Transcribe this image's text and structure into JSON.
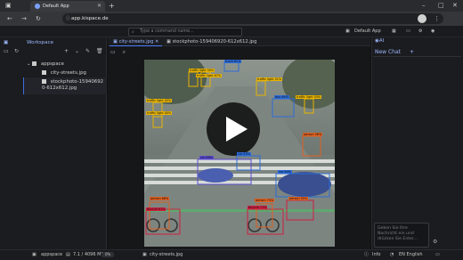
{
  "browser": {
    "tab_title": "Default App",
    "new_tab": "+",
    "url": "app.kispace.de",
    "minimize": "–",
    "maximize": "□",
    "close": "✕",
    "back": "←",
    "forward": "→",
    "reload": "↻",
    "menu": "⋮"
  },
  "apptop": {
    "command_placeholder": "Type a command name...",
    "app_name": "Default App"
  },
  "workspace": {
    "title": "Workspace",
    "root": "appspace",
    "files": [
      "city-streets.jpg",
      "stockphoto-159406920-612x612.jpg"
    ]
  },
  "editor": {
    "tabs": [
      "city-streets.jpg",
      "stockphoto-159406920-612x612.jpg"
    ],
    "detections": [
      {
        "label": "traffic light 50%",
        "color": "#e8b400"
      },
      {
        "label": "traffic light 67%",
        "color": "#e8b400"
      },
      {
        "label": "traffic light 51%",
        "color": "#e8b400"
      },
      {
        "label": "traffic light 45%",
        "color": "#e8b400"
      },
      {
        "label": "traffic light 40%",
        "color": "#e8b400"
      },
      {
        "label": "traffic light 54%",
        "color": "#e8b400"
      },
      {
        "label": "truck 61%",
        "color": "#2b6bd8"
      },
      {
        "label": "bus 49%",
        "color": "#2b6bd8"
      },
      {
        "label": "car 43%",
        "color": "#2b6bd8"
      },
      {
        "label": "person 58%",
        "color": "#e06020"
      },
      {
        "label": "car 88%",
        "color": "#5a4ad0"
      },
      {
        "label": "car 64%",
        "color": "#2b6bd8"
      },
      {
        "label": "person 66%",
        "color": "#e06020"
      },
      {
        "label": "bicycle 61%",
        "color": "#d02040"
      },
      {
        "label": "bicycle 71%",
        "color": "#d02040"
      },
      {
        "label": "person 73%",
        "color": "#e06020"
      },
      {
        "label": "person 55%",
        "color": "#e06020"
      }
    ]
  },
  "chat": {
    "tab": "AI",
    "new_chat": "New Chat",
    "add": "+",
    "input_placeholder": "Geben Sie Ihre Nachricht ein und drücken Sie Enter..."
  },
  "status": {
    "workspace": "appspace",
    "memory": "7.1 / 4096 MB",
    "progress_percent": 0,
    "progress_label": "0%",
    "file": "city-streets.jpg",
    "info": "Info",
    "language": "EN English"
  }
}
